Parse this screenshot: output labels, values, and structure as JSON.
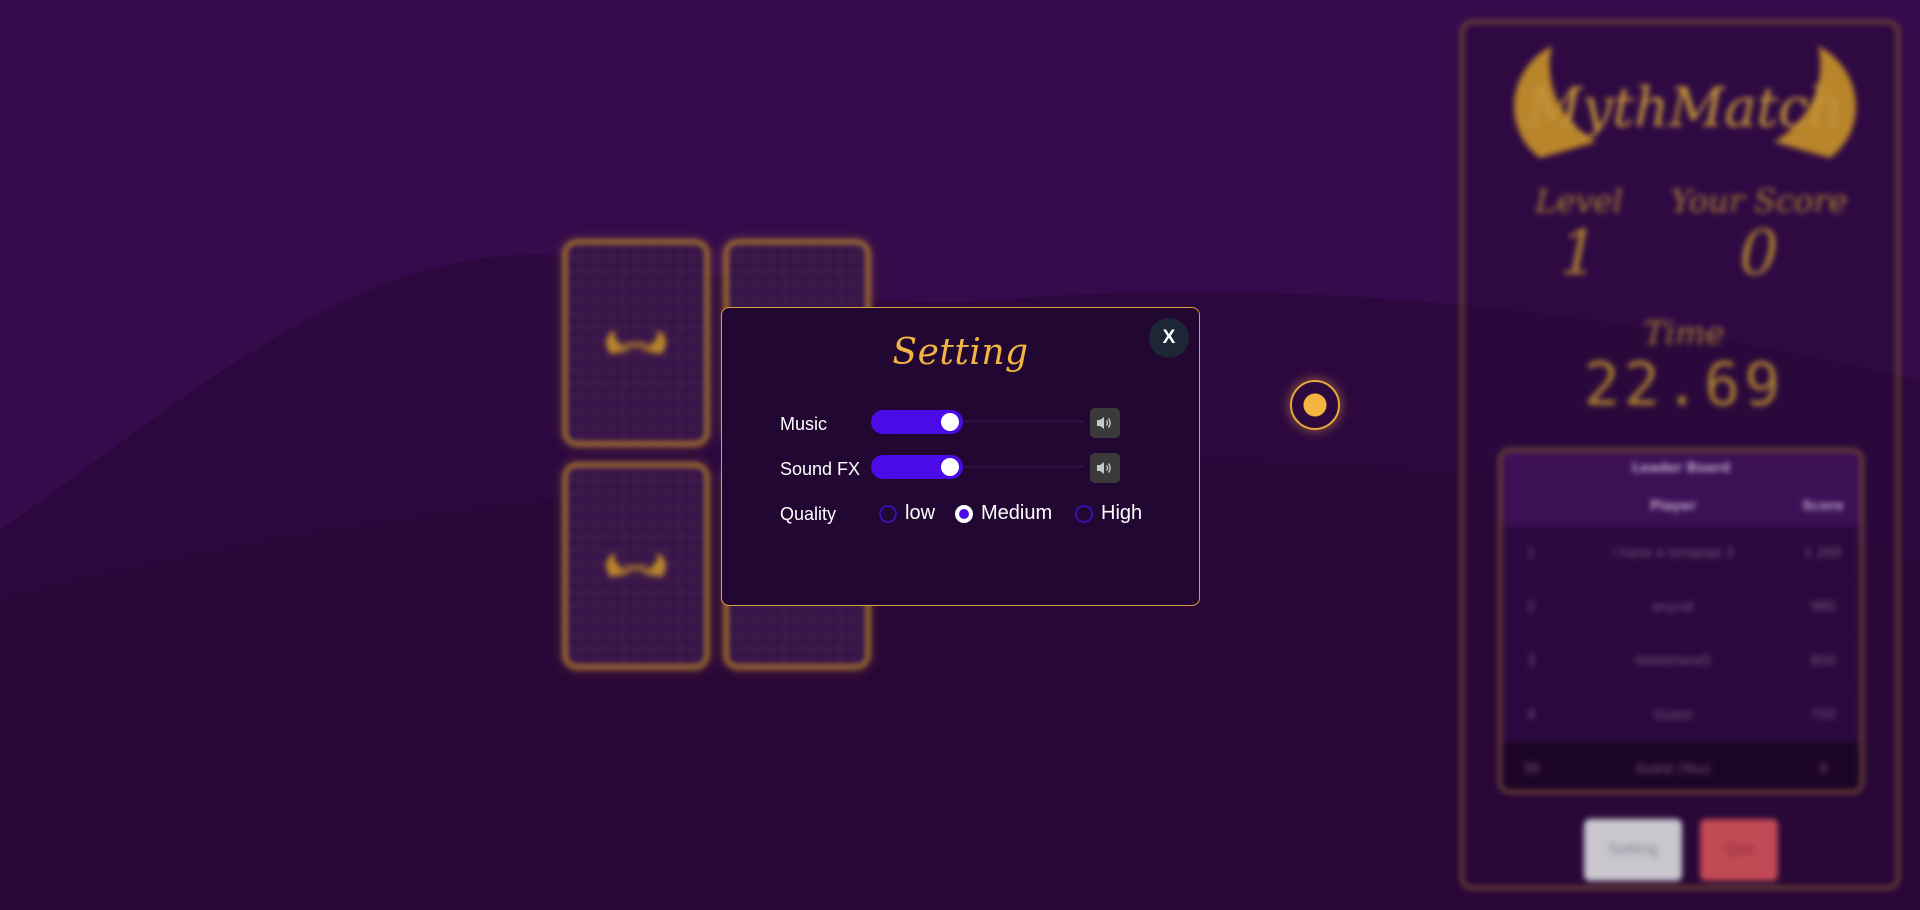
{
  "game": {
    "logo_text": "MythMatch",
    "level_label": "Level",
    "level_value": "1",
    "score_label": "Your Score",
    "score_value": "0",
    "time_label": "Time",
    "time_value": "22.69",
    "leaderboard": {
      "title": "Leader Board",
      "headers": {
        "rank": "",
        "player": "Player",
        "score": "Score"
      },
      "rows": [
        {
          "rank": "1",
          "player": "I have a templae 2",
          "score": "1 260"
        },
        {
          "rank": "2",
          "player": "anyrat",
          "score": "980"
        },
        {
          "rank": "3",
          "player": "Hellothere5",
          "score": "850"
        },
        {
          "rank": "4",
          "player": "Guest",
          "score": "750"
        },
        {
          "rank": "39",
          "player": "Guest (You)",
          "score": "0"
        }
      ]
    },
    "setting_button": "Setting",
    "quit_button": "Quit"
  },
  "modal": {
    "title": "Setting",
    "close_label": "X",
    "music_label": "Music",
    "music_level": 0.43,
    "sfx_label": "Sound FX",
    "sfx_level": 0.43,
    "quality_label": "Quality",
    "quality_options": [
      "low",
      "Medium",
      "High"
    ],
    "quality_selected": "Medium"
  },
  "icons": {
    "volume": "volume-icon",
    "wing": "wing-emblem-icon",
    "cursor": "cursor-dot-icon"
  },
  "colors": {
    "background": "#2a0738",
    "accent_gold": "#f3b443",
    "slider_fill": "#4a0be8",
    "modal_bg": "#210731"
  }
}
